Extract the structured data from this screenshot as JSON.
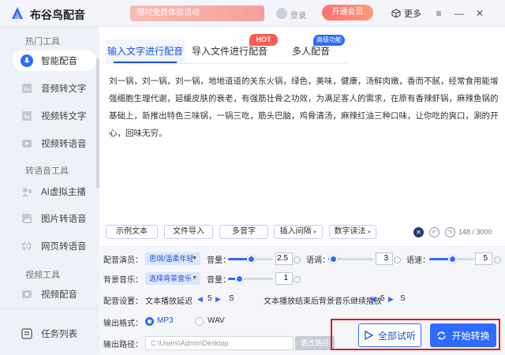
{
  "app": {
    "title": "布谷鸟配音",
    "promo_text": "限时免费体验活动",
    "user_name": "登录",
    "vip_text": "开通会员",
    "more_label": "更多",
    "brand_color": "#2f6bff"
  },
  "sidebar": {
    "sections": [
      {
        "title": "热门工具",
        "items": [
          {
            "label": "智能配音",
            "icon": "microphone-icon",
            "active": true
          },
          {
            "label": "音频转文字",
            "icon": "audio-to-text-icon"
          },
          {
            "label": "视频转文字",
            "icon": "video-to-text-icon"
          },
          {
            "label": "视频转语音",
            "icon": "video-to-audio-icon"
          }
        ]
      },
      {
        "title": "转语音工具",
        "items": [
          {
            "label": "AI虚拟主播",
            "icon": "virtual-host-icon"
          },
          {
            "label": "图片转语音",
            "icon": "image-to-audio-icon"
          },
          {
            "label": "网页转语音",
            "icon": "webpage-to-audio-icon"
          }
        ]
      },
      {
        "title": "视频工具",
        "items": [
          {
            "label": "视频配音",
            "icon": "video-dub-icon"
          }
        ]
      }
    ],
    "task_list_label": "任务列表"
  },
  "tabs": [
    {
      "label": "输入文字进行配音",
      "active": true
    },
    {
      "label": "导入文件进行配音",
      "badge": "HOT"
    },
    {
      "label": "多人配音",
      "badge": "高级功能"
    }
  ],
  "editor": {
    "text": "刘一锅，刘一锅，刘一锅，地地道道的关东火锅，绿色，美味，健康，汤鲜肉嫩，香而不腻，经常食用能增强细胞生理代谢，延缓皮肤的衰老，有强筋壮骨之功效，为满足客人的需求，在原有香辣虾锅，麻辣鱼锅的基础上，新推出特色三味锅，一锅三吃，筋头巴脑，鸡骨清汤，麻辣红油三种口味，让你吃的爽口，涮的开心，回味无穷。",
    "char_count": "148 / 3000"
  },
  "toolbar": {
    "sample_text": "示例文本",
    "import_file": "文件导入",
    "polyphone": "多音字",
    "insert_pause": "插入间隔",
    "number_reading": "数字读法"
  },
  "settings": {
    "voice_label": "配音演员：",
    "voice_value": "思琪/温柔年轻",
    "volume_label": "音量：",
    "volume_value": "2.5",
    "volume_fraction": 0.5,
    "pitch_label": "语调：",
    "pitch_value": "3",
    "pitch_fraction": 0.1,
    "speed_label": "语速：",
    "speed_value": "5",
    "speed_fraction": 0.5,
    "bgm_label": "背景音乐：",
    "bgm_value": "选择背景音乐",
    "bgm_volume_label": "音量：",
    "bgm_volume_value": "1",
    "bgm_volume_fraction": 0.25,
    "dub_setting_label": "配音设置：",
    "text_delay_label": "文本播放延迟",
    "text_delay_value": "5",
    "text_delay_unit": "S",
    "bgm_continue_label": "文本播放结束后背景音乐继续播放",
    "bgm_continue_value": "5",
    "bgm_continue_unit": "S",
    "format_label": "输出格式：",
    "format_mp3": "MP3",
    "format_wav": "WAV",
    "path_label": "输出路径：",
    "path_value": "C:\\Users\\Admin\\Desktop",
    "change_path": "更改路径"
  },
  "actions": {
    "preview_all": "全部试听",
    "start_convert": "开始转换"
  }
}
